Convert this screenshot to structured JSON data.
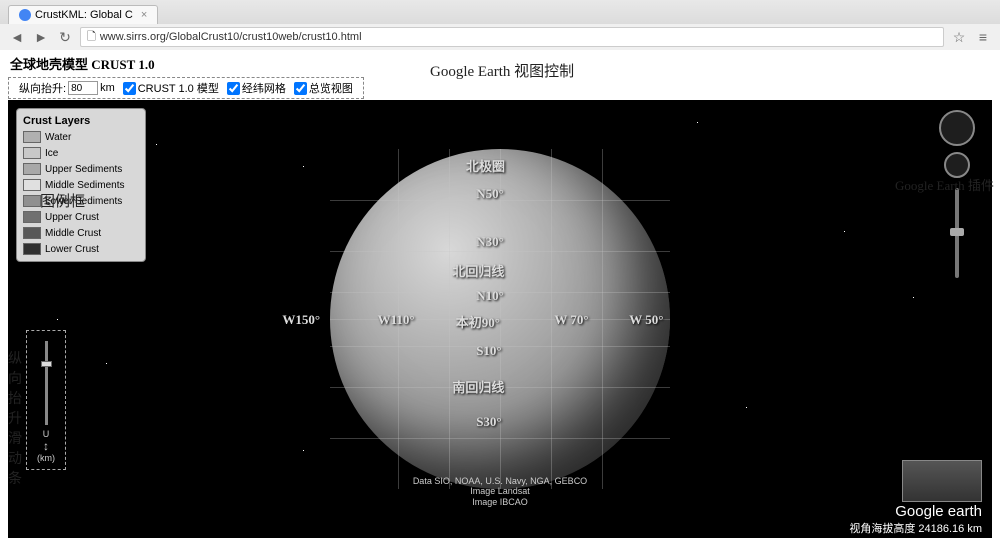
{
  "browser": {
    "tab_title": "CrustKML: Global C",
    "url": "www.sirrs.org/GlobalCrust10/crust10web/crust10.html"
  },
  "page": {
    "title": "全球地壳模型 CRUST 1.0"
  },
  "controls": {
    "uplift_label": "纵向抬升:",
    "uplift_value": "80",
    "uplift_unit": "km",
    "model_label": "CRUST 1.0 模型",
    "grid_label": "经纬网格",
    "overview_label": "总览视图"
  },
  "legend": {
    "title": "Crust Layers",
    "items": [
      {
        "label": "Water",
        "color": "#b0b0b0"
      },
      {
        "label": "Ice",
        "color": "#c8c8c8"
      },
      {
        "label": "Upper Sediments",
        "color": "#a8a8a8"
      },
      {
        "label": "Middle Sediments",
        "color": "#e0e0e0"
      },
      {
        "label": "Lower Sediments",
        "color": "#909090"
      },
      {
        "label": "Upper Crust",
        "color": "#707070"
      },
      {
        "label": "Middle Crust",
        "color": "#585858"
      },
      {
        "label": "Lower Crust",
        "color": "#303030"
      }
    ]
  },
  "slider": {
    "top_mark": "U",
    "bottom_mark": "(km)"
  },
  "globe_labels": {
    "arctic": "北极圈",
    "n50": "N50°",
    "n30": "N30°",
    "tropic_n": "北回归线",
    "n10": "N10°",
    "s10": "S10°",
    "tropic_s": "南回归线",
    "s30": "S30°",
    "w150": "W150°",
    "w110": "W110°",
    "prime": "本初90°",
    "w70": "W 70°",
    "w50": "W 50°"
  },
  "attribution": {
    "line1": "Data SIO, NOAA, U.S. Navy, NGA, GEBCO",
    "line2": "Image Landsat",
    "line3": "Image IBCAO"
  },
  "status": {
    "altitude_label": "视角海拔高度",
    "altitude_value": "24186.16 km"
  },
  "logo": {
    "text": "Google earth"
  },
  "annotations": {
    "legend": "图例框",
    "slider": "纵向抬升滑动条",
    "controls": "Google Earth 视图控制",
    "plugin": "Google Earth 插件"
  }
}
